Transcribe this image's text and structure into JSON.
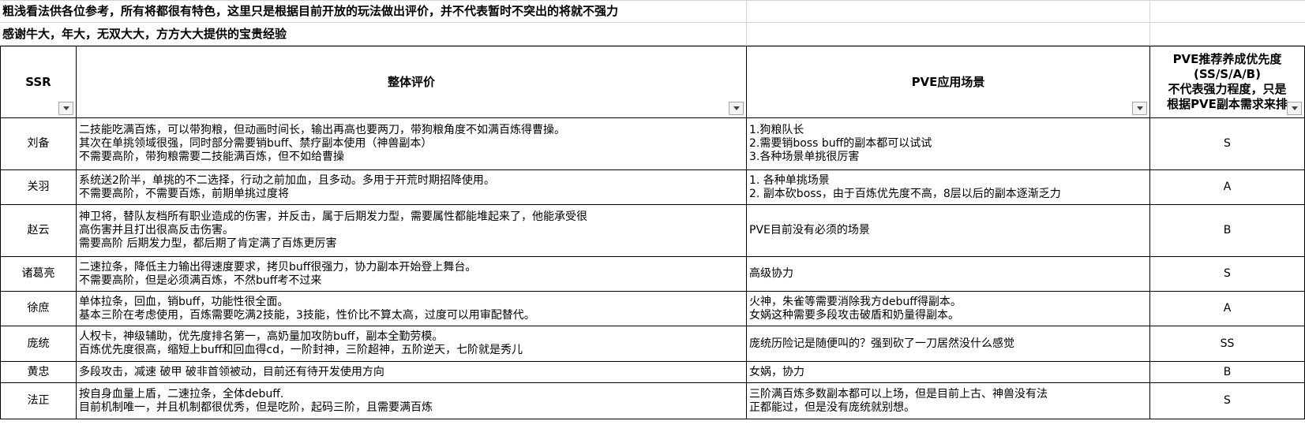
{
  "notes": [
    "粗浅看法供各位参考，所有将都很有特色，这里只是根据目前开放的玩法做出评价，并不代表暂时不突出的将就不强力",
    "感谢牛大，年大，无双大大，方方大大提供的宝贵经验"
  ],
  "headers": {
    "ssr": "SSR",
    "overall": "整体评价",
    "pve_scene": "PVE应用场景",
    "priority_line1": "PVE推荐养成优先度",
    "priority_line2": "(SS/S/A/B)",
    "priority_line3": "不代表强力程度，只是",
    "priority_line4": "根据PVE副本需求来排"
  },
  "rows": [
    {
      "name": "刘备",
      "overall": [
        "二技能吃满百炼，可以带狗粮，但动画时间长，输出再高也要两刀，带狗粮角度不如满百炼得曹操。",
        "其次在单挑领域很强，同时部分需要销buff、禁疗副本使用（神兽副本）",
        "不需要高阶，带狗粮需要二技能满百炼，但不如给曹操"
      ],
      "scene": [
        "1.狗粮队长",
        "2.需要销boss buff的副本都可以试试",
        "3.各种场景单挑很厉害"
      ],
      "grade": "S"
    },
    {
      "name": "关羽",
      "overall": [
        "系统送2阶半，单挑的不二选择，行动之前加血，且多动。多用于开荒时期招降使用。",
        "不需要高阶，不需要百炼，前期单挑过度将"
      ],
      "scene": [
        "1. 各种单挑场景",
        "2. 副本砍boss，由于百炼优先度不高，8层以后的副本逐渐乏力"
      ],
      "grade": "A"
    },
    {
      "name": "赵云",
      "overall": [
        "神卫将，替队友档所有职业造成的伤害，并反击，属于后期发力型，需要属性都能堆起来了，他能承受很",
        "高伤害并且打出很高反击伤害。",
        "需要高阶 后期发力型，都后期了肯定满了百炼更厉害"
      ],
      "scene": [
        "PVE目前没有必须的场景"
      ],
      "grade": "B"
    },
    {
      "name": "诸葛亮",
      "overall": [
        "二速拉条，降低主力输出得速度要求，拷贝buff很强力，协力副本开始登上舞台。",
        "不需要高阶，但是必须满百炼，不然buff考不过来"
      ],
      "scene": [
        "高级协力"
      ],
      "grade": "S"
    },
    {
      "name": "徐庶",
      "overall": [
        "单体拉条，回血，销buff，功能性很全面。",
        "基本三阶在考虑使用，百炼需要吃满2技能，3技能，性价比不算太高，过度可以用审配替代。"
      ],
      "scene": [
        "火神，朱雀等需要消除我方debuff得副本。",
        "女娲这种需要多段攻击破盾和奶量得副本。"
      ],
      "grade": "A"
    },
    {
      "name": "庞统",
      "overall": [
        "人权卡，神级辅助，优先度排名第一，高奶量加攻防buff，副本全勤劳模。",
        "百炼优先度很高，缩短上buff和回血得cd，一阶封神，三阶超神，五阶逆天，七阶就是秀儿"
      ],
      "scene": [
        "庞统历险记是随便叫的？强到砍了一刀居然没什么感觉"
      ],
      "grade": "SS"
    },
    {
      "name": "黄忠",
      "overall": [
        "多段攻击，减速 破甲 破非首领被动，目前还有待开发使用方向"
      ],
      "scene": [
        "女娲，协力"
      ],
      "grade": "B"
    },
    {
      "name": "法正",
      "overall": [
        "按自身血量上盾，二速拉条，全体debuff.",
        "目前机制唯一，并且机制都很优秀，但是吃阶，起码三阶，且需要满百炼"
      ],
      "scene": [
        "三阶满百炼多数副本都可以上场，但是目前上古、神兽没有法",
        "正都能过，但是没有庞统就别想。"
      ],
      "grade": "S"
    }
  ]
}
